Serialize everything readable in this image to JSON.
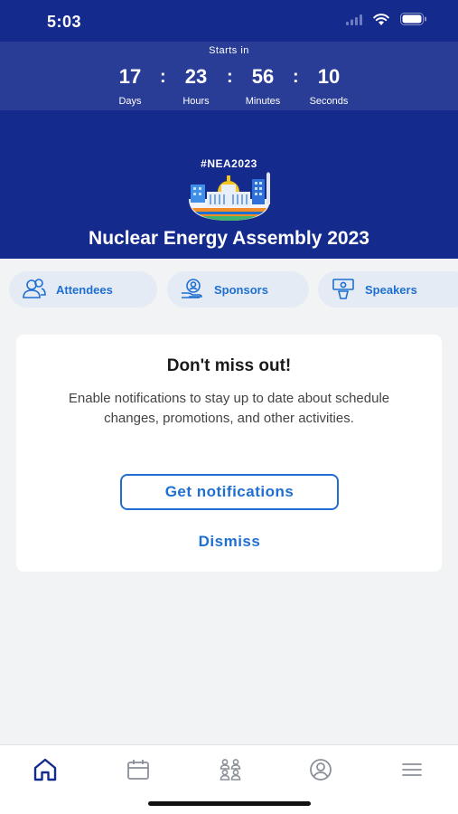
{
  "status": {
    "time": "5:03"
  },
  "countdown": {
    "title": "Starts in",
    "units": [
      {
        "value": "17",
        "label": "Days"
      },
      {
        "value": "23",
        "label": "Hours"
      },
      {
        "value": "56",
        "label": "Minutes"
      },
      {
        "value": "10",
        "label": "Seconds"
      }
    ],
    "separator": ":"
  },
  "event": {
    "hashtag": "#NEA2023",
    "title": "Nuclear Energy Assembly 2023"
  },
  "chips": [
    {
      "label": "Attendees",
      "icon": "attendees-icon"
    },
    {
      "label": "Sponsors",
      "icon": "sponsors-icon"
    },
    {
      "label": "Speakers",
      "icon": "speakers-icon"
    }
  ],
  "notification_card": {
    "title": "Don't miss out!",
    "body": "Enable notifications to stay up to date about schedule changes, promotions, and other activities.",
    "primary_button": "Get notifications",
    "secondary_button": "Dismiss"
  },
  "tab_bar": [
    {
      "icon": "home-icon",
      "active": true
    },
    {
      "icon": "calendar-icon",
      "active": false
    },
    {
      "icon": "people-icon",
      "active": false
    },
    {
      "icon": "profile-icon",
      "active": false
    },
    {
      "icon": "menu-icon",
      "active": false
    }
  ],
  "colors": {
    "header_navy": "#142a8c",
    "countdown_band": "#2a3d96",
    "accent_blue": "#1f6fd1",
    "chip_background": "#e4ebf4",
    "page_background": "#f2f3f5"
  }
}
